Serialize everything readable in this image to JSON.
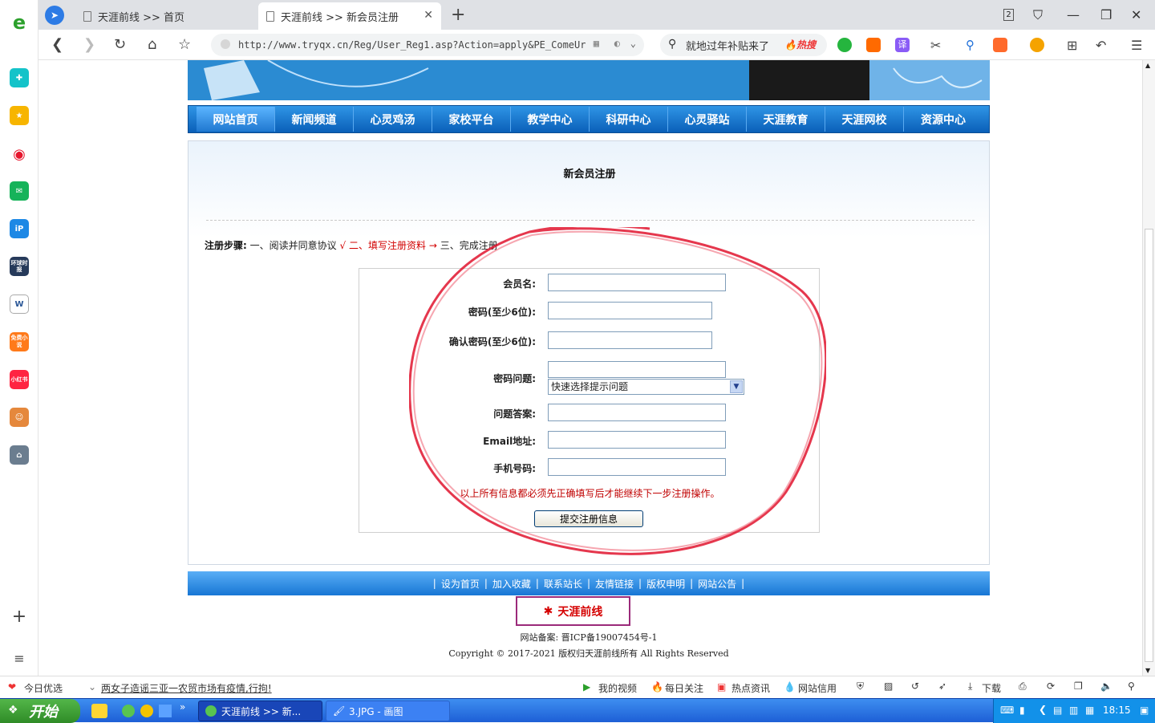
{
  "browser": {
    "tabs": [
      {
        "label": "天涯前线 >> 首页"
      },
      {
        "label": "天涯前线 >> 新会员注册"
      }
    ],
    "tab_count_badge": "2",
    "url": "http://www.tryqx.cn/Reg/User_Reg1.asp?Action=apply&PE_ComeUr",
    "search_placeholder": "就地过年补贴来了",
    "search_hot": "热搜",
    "sidebar_icons": [
      "browser-logo-icon",
      "add-green-icon",
      "favorites-star-icon",
      "weibo-icon",
      "mail-icon",
      "ip-icon",
      "news-icon",
      "word-doc-icon",
      "free-novel-icon",
      "xiaohongshu-icon",
      "game-character-icon",
      "game-town-icon",
      "plus-icon",
      "list-icon"
    ],
    "sidebar_labels": {
      "novel": "免费小说",
      "xhs": "小红书",
      "news": "环球时报"
    }
  },
  "site": {
    "nav": [
      "网站首页",
      "新闻频道",
      "心灵鸡汤",
      "家校平台",
      "教学中心",
      "科研中心",
      "心灵驿站",
      "天涯教育",
      "天涯网校",
      "资源中心"
    ],
    "page_title": "新会员注册",
    "steps": {
      "prefix": "注册步骤:",
      "step1": "一、阅读并同意协议",
      "check": "√",
      "step2": "二、填写注册资料",
      "arrow": "→",
      "step3": "三、完成注册"
    },
    "form": {
      "username_label": "会员名:",
      "password_label": "密码(至少6位):",
      "confirm_label": "确认密码(至少6位):",
      "question_label": "密码问题:",
      "question_select": "快速选择提示问题",
      "answer_label": "问题答案:",
      "email_label": "Email地址:",
      "phone_label": "手机号码:",
      "notice": "以上所有信息都必须先正确填写后才能继续下一步注册操作。",
      "submit": "提交注册信息"
    },
    "footer_links": [
      "设为首页",
      "加入收藏",
      "联系站长",
      "友情链接",
      "版权申明",
      "网站公告"
    ],
    "logo_text": "天涯前线",
    "icp": "网站备案: 晋ICP备19007454号-1",
    "copyright": "Copyright © 2017-2021 版权归天涯前线所有 All Rights Reserved"
  },
  "statusbar": {
    "today": "今日优选",
    "headline": "两女子造谣三亚一农贸市场有疫情,行拘!",
    "my_video": "我的视频",
    "daily": "每日关注",
    "hot_news": "热点资讯",
    "credit": "网站信用",
    "download": "下载"
  },
  "taskbar": {
    "start": "开始",
    "task1": "天涯前线 >> 新...",
    "task2": "3.JPG - 画图",
    "time": "18:15"
  },
  "colors": {
    "nav_blue": "#0a5fb8",
    "annotation_red": "#e0142e",
    "notice_red": "#c00000"
  }
}
